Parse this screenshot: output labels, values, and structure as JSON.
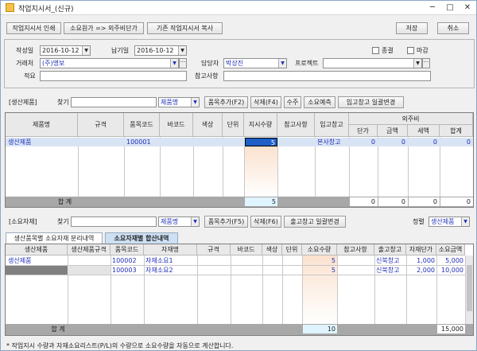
{
  "window": {
    "title": "작업지시서_(신규)",
    "minimize": "─",
    "maximize": "□",
    "close": "✕"
  },
  "toolbar": {
    "print": "작업지시서 인쇄",
    "cost": "소요원가 => 외주비단가",
    "copy": "기존 작업지시서 복사",
    "save": "저장",
    "cancel": "취소"
  },
  "form": {
    "write_date_label": "작성일",
    "write_date": "2016-10-12",
    "due_date_label": "납기일",
    "due_date": "2016-10-12",
    "finish_label": "종결",
    "close_label": "마감",
    "client_label": "거래처",
    "client": "(주)명보",
    "manager_label": "담당자",
    "manager": "박상진",
    "project_label": "프로젝트",
    "project": "",
    "memo_label": "적요",
    "memo": "",
    "reference_label": "참고사항",
    "reference": ""
  },
  "production": {
    "section_label": "[생산제품]",
    "search_label": "찾기",
    "search_value": "",
    "field_select": "제품명",
    "add_btn": "품목추가(F2)",
    "delete_btn": "삭제(F4)",
    "qty_btn": "수주",
    "forecast_btn": "소요예측",
    "warehouse_btn": "입고창고 일괄변경",
    "columns": {
      "name": "제품명",
      "spec": "규격",
      "code": "품목코드",
      "barcode": "바코드",
      "color": "색상",
      "unit": "단위",
      "qty": "지시수량",
      "note": "참고사항",
      "wh": "입고창고",
      "outsource": "외주비",
      "price": "단가",
      "amount": "금액",
      "tax": "세액",
      "total": "합계"
    },
    "rows": [
      {
        "name": "생산제품",
        "code": "100001",
        "qty": "5",
        "wh": "본사창고",
        "price": "0",
        "amount": "0",
        "tax": "0",
        "total": "0"
      }
    ],
    "sum": {
      "label": "합 계",
      "qty": "5",
      "price": "0",
      "amount": "0",
      "tax": "0",
      "total": "0"
    }
  },
  "material": {
    "section_label": "[소요자재]",
    "search_label": "찾기",
    "search_value": "",
    "field_select": "제품명",
    "add_btn": "품목추가(F5)",
    "delete_btn": "삭제(F6)",
    "warehouse_btn": "출고창고 일괄변경",
    "sort_label": "정렬",
    "sort_value": "생산제품",
    "tab1": "생산품목별 소요자재 분리내역",
    "tab2": "소요자재별 합산내역",
    "columns": {
      "product": "생산제품",
      "pspec": "생산제품규격",
      "code": "품목코드",
      "name": "자재명",
      "spec": "규격",
      "barcode": "바코드",
      "color": "색상",
      "unit": "단위",
      "qty": "소요수량",
      "note": "참고사항",
      "wh": "출고창고",
      "price": "자재단가",
      "amount": "소요금액"
    },
    "rows": [
      {
        "product": "생산제품",
        "code": "100002",
        "name": "자재소요1",
        "qty": "5",
        "wh": "신북창고",
        "price": "1,000",
        "amount": "5,000"
      },
      {
        "product": "",
        "code": "100003",
        "name": "자재소요2",
        "qty": "5",
        "wh": "신북창고",
        "price": "2,000",
        "amount": "10,000"
      }
    ],
    "sum": {
      "label": "합 계",
      "qty": "10",
      "amount": "15,000"
    }
  },
  "footer": {
    "note": "* 작업지시 수량과 자재소요리스트(P/L)의 수량으로 소요수량을 자동으로 계산합니다."
  }
}
